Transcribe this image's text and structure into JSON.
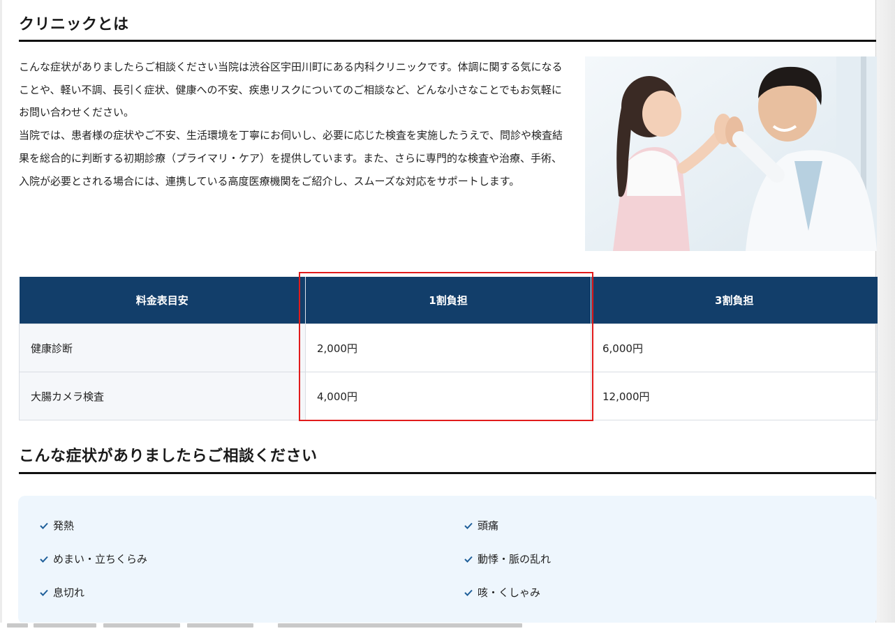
{
  "clinic_section": {
    "title": "クリニックとは",
    "paragraphs": [
      "こんな症状がありましたらご相談ください当院は渋谷区宇田川町にある内科クリニックです。体調に関する気になることや、軽い不調、長引く症状、健康への不安、疾患リスクについてのご相談など、どんな小さなことでもお気軽にお問い合わせください。",
      "当院では、患者様の症状やご不安、生活環境を丁寧にお伺いし、必要に応じた検査を実施したうえで、問診や検査結果を総合的に判断する初期診療（プライマリ・ケア）を提供しています。また、さらに専門的な検査や治療、手術、入院が必要とされる場合には、連携している高度医療機関をご紹介し、スムーズな対応をサポートします。"
    ]
  },
  "fee_table": {
    "headers": [
      "料金表目安",
      "1割負担",
      "3割負担"
    ],
    "rows": [
      [
        "健康診断",
        "2,000円",
        "6,000円"
      ],
      [
        "大腸カメラ検査",
        "4,000円",
        "12,000円"
      ]
    ]
  },
  "symptoms_section": {
    "title": "こんな症状がありましたらご相談ください",
    "items": [
      "発熱",
      "頭痛",
      "めまい・立ちくらみ",
      "動悸・脈の乱れ",
      "息切れ",
      "咳・くしゃみ"
    ]
  },
  "colors": {
    "table_header_bg": "#123e6a",
    "highlight_border": "#e11b1b",
    "symptom_panel_bg": "#eef6fd",
    "check_icon": "#1f5f9a"
  }
}
